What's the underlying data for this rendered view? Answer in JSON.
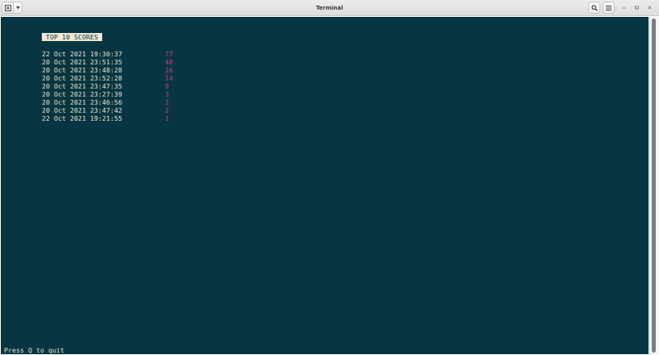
{
  "window": {
    "title": "Terminal",
    "new_tab_icon": "new-tab-icon",
    "dropdown_icon": "chevron-down-icon",
    "search_icon": "search-icon",
    "menu_icon": "hamburger-menu-icon",
    "minimize_icon": "minimize-icon",
    "maximize_icon": "maximize-icon",
    "close_icon": "close-icon"
  },
  "scores": {
    "header": "TOP 10 SCORES",
    "rows": [
      {
        "date": "22 Oct 2021 19:30:37",
        "score": "77"
      },
      {
        "date": "20 Oct 2021 23:51:35",
        "score": "48"
      },
      {
        "date": "20 Oct 2021 23:48:28",
        "score": "16"
      },
      {
        "date": "20 Oct 2021 23:52:28",
        "score": "14"
      },
      {
        "date": "20 Oct 2021 23:47:35",
        "score": "9"
      },
      {
        "date": "20 Oct 2021 23:27:39",
        "score": "3"
      },
      {
        "date": "20 Oct 2021 23:46:56",
        "score": "2"
      },
      {
        "date": "20 Oct 2021 23:47:42",
        "score": "2"
      },
      {
        "date": "22 Oct 2021 19:21:55",
        "score": "1"
      }
    ]
  },
  "footer": {
    "quit_hint": "Press Q to quit"
  },
  "colors": {
    "terminal_background": "#073642",
    "terminal_foreground": "#eee8d5",
    "score_value": "#d33682"
  }
}
